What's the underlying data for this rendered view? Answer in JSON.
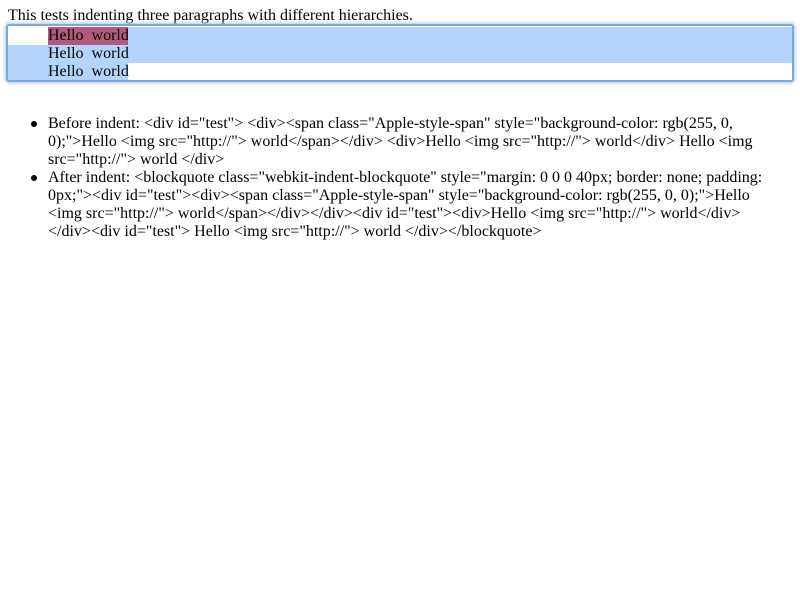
{
  "intro_text": "This tests indenting three paragraphs with different hierarchies.",
  "editor": {
    "lines": [
      "Hello  world",
      "Hello  world",
      "Hello  world"
    ]
  },
  "results": [
    "Before indent: <div id=\"test\"> <div><span class=\"Apple-style-span\" style=\"background-color: rgb(255, 0, 0);\">Hello <img src=\"http://\"> world</span></div> <div>Hello <img src=\"http://\"> world</div> Hello <img src=\"http://\"> world </div>",
    "After indent: <blockquote class=\"webkit-indent-blockquote\" style=\"margin: 0 0 0 40px; border: none; padding: 0px;\"><div id=\"test\"><div><span class=\"Apple-style-span\" style=\"background-color: rgb(255, 0, 0);\">Hello <img src=\"http://\"> world</span></div></div><div id=\"test\"><div>Hello <img src=\"http://\"> world</div></div><div id=\"test\"> Hello <img src=\"http://\"> world </div></blockquote>"
  ],
  "colors": {
    "selection": "#b4d4fc",
    "red_span_selected": "#b4597e",
    "focus_ring": "#7aa8e0"
  }
}
